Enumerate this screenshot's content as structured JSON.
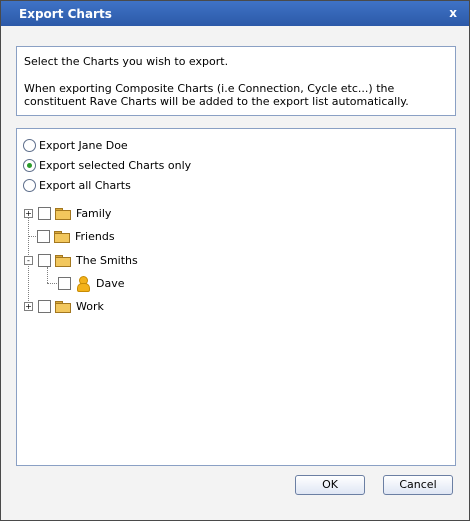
{
  "window": {
    "title": "Export Charts",
    "close_label": "x"
  },
  "info": {
    "line1": "Select the Charts you wish to export.",
    "line2": "When exporting Composite Charts (i.e Connection, Cycle etc...) the",
    "line3": "constituent Rave Charts will be added to the export list automatically."
  },
  "options": [
    {
      "label": "Export Jane Doe",
      "checked": false
    },
    {
      "label": "Export selected Charts only",
      "checked": true
    },
    {
      "label": "Export all Charts",
      "checked": false
    }
  ],
  "tree": [
    {
      "label": "Family",
      "icon": "folder-icon",
      "expander": "+"
    },
    {
      "label": "Friends",
      "icon": "folder-icon",
      "expander": ""
    },
    {
      "label": "The Smiths",
      "icon": "folder-icon",
      "expander": "-"
    },
    {
      "label": "Dave",
      "icon": "person-icon",
      "expander": ""
    },
    {
      "label": "Work",
      "icon": "folder-icon",
      "expander": "+"
    }
  ],
  "buttons": {
    "ok": "OK",
    "cancel": "Cancel"
  }
}
